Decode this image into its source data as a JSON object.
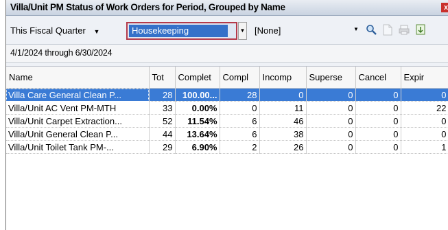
{
  "window": {
    "title": "Villa/Unit PM Status of Work Orders for Period, Grouped by Name",
    "close_label": "x"
  },
  "toolbar": {
    "period": "This Fiscal Quarter",
    "period_arrow": "▼",
    "category": "Housekeeping",
    "category_arrow": "▼",
    "secondary": "[None]",
    "secondary_arrow": "▼",
    "icons": [
      "search-icon",
      "document-icon",
      "print-icon",
      "export-icon"
    ]
  },
  "date_range": "4/1/2024 through 6/30/2024",
  "table": {
    "columns": [
      "Name",
      "Tot",
      "Complet",
      "Compl",
      "Incomp",
      "Superse",
      "Cancel",
      "Expir"
    ],
    "rows": [
      [
        "Villa Care General Clean P...",
        "28",
        "100.00...",
        "28",
        "0",
        "0",
        "0",
        "0"
      ],
      [
        "Villa/Unit AC Vent PM-MTH",
        "33",
        "0.00%",
        "0",
        "11",
        "0",
        "0",
        "22"
      ],
      [
        "Villa/Unit Carpet Extraction...",
        "52",
        "11.54%",
        "6",
        "46",
        "0",
        "0",
        "0"
      ],
      [
        "Villa/Unit General Clean P...",
        "44",
        "13.64%",
        "6",
        "38",
        "0",
        "0",
        "0"
      ],
      [
        "Villa/Unit Toilet Tank PM-...",
        "29",
        "6.90%",
        "2",
        "26",
        "0",
        "0",
        "1"
      ]
    ],
    "selected_row": 0
  }
}
